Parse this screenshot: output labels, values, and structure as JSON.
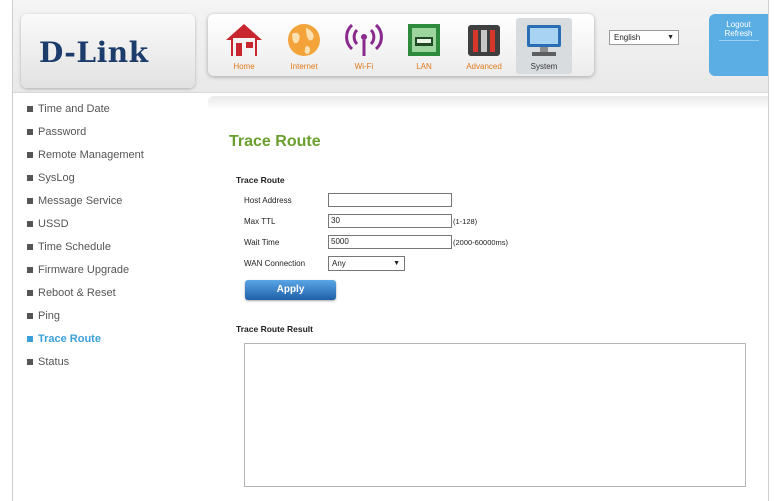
{
  "brand": {
    "logo": "D-Link"
  },
  "nav": [
    {
      "label": "Home",
      "icon": "home-icon"
    },
    {
      "label": "Internet",
      "icon": "globe-icon"
    },
    {
      "label": "Wi-Fi",
      "icon": "wifi-icon"
    },
    {
      "label": "LAN",
      "icon": "lan-icon"
    },
    {
      "label": "Advanced",
      "icon": "tools-icon"
    },
    {
      "label": "System",
      "icon": "computer-icon"
    }
  ],
  "language": {
    "selected": "English"
  },
  "user": {
    "logout": "Logout",
    "refresh": "Refresh"
  },
  "sidebar": {
    "items": [
      {
        "label": "Time and Date"
      },
      {
        "label": "Password"
      },
      {
        "label": "Remote Management"
      },
      {
        "label": "SysLog"
      },
      {
        "label": "Message Service"
      },
      {
        "label": "USSD"
      },
      {
        "label": "Time Schedule"
      },
      {
        "label": "Firmware Upgrade"
      },
      {
        "label": "Reboot & Reset"
      },
      {
        "label": "Ping"
      },
      {
        "label": "Trace Route"
      },
      {
        "label": "Status"
      }
    ],
    "active_label": "Trace Route"
  },
  "main": {
    "title": "Trace Route",
    "form_title": "Trace Route",
    "fields": {
      "host": {
        "label": "Host Address",
        "value": ""
      },
      "ttl": {
        "label": "Max TTL",
        "value": "30",
        "hint": "(1-128)"
      },
      "wait": {
        "label": "Wait Time",
        "value": "5000",
        "hint": "(2000-60000ms)"
      },
      "wan": {
        "label": "WAN Connection",
        "value": "Any"
      }
    },
    "apply_label": "Apply",
    "result_title": "Trace Route Result"
  },
  "colors": {
    "accent_blue": "#3ba0d8",
    "title_green": "#6a9f2e",
    "logo_navy": "#1c3c6c",
    "nav_orange": "#e07a1b"
  }
}
